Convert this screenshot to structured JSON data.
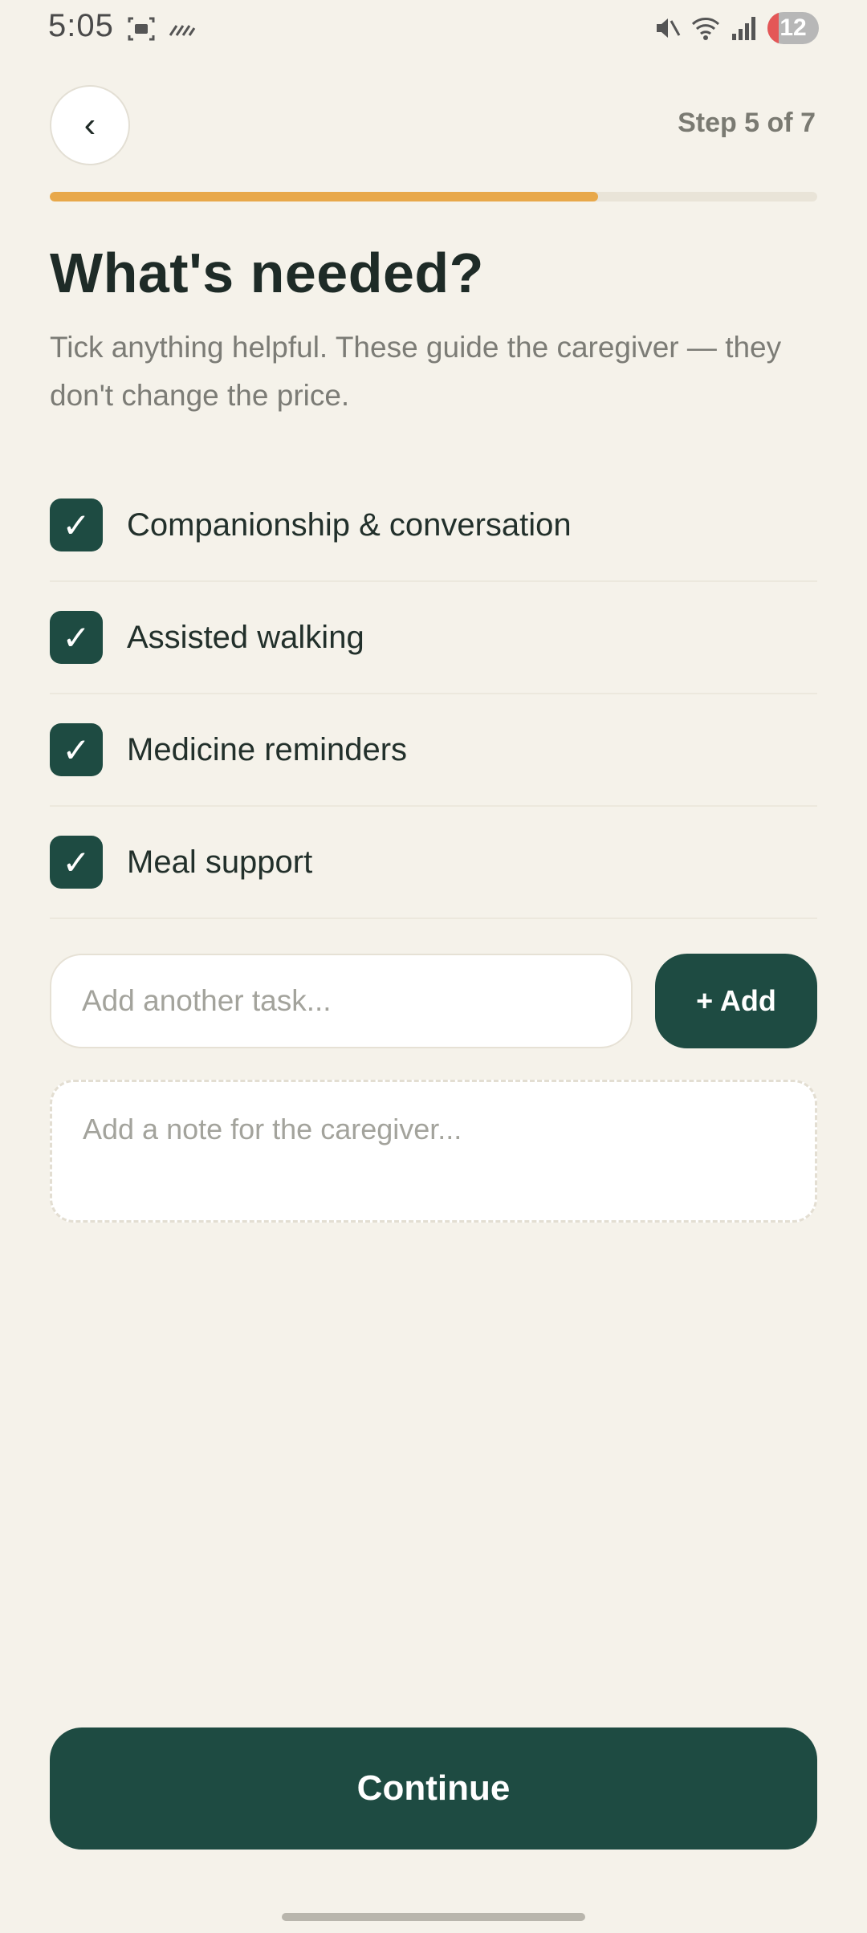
{
  "status_bar": {
    "time": "5:05",
    "left_icons": [
      "screenshot-icon",
      "nfc-icon"
    ],
    "right_icons": [
      "mute-icon",
      "wifi-icon",
      "signal-icon"
    ],
    "notification_count": "12"
  },
  "header": {
    "back_label": "‹",
    "step_label": "Step 5 of 7",
    "progress": 0.714
  },
  "page": {
    "title": "What's needed?",
    "subtitle": "Tick anything helpful. These guide the caregiver — they don't change the price."
  },
  "tasks": [
    {
      "label": "Companionship & conversation",
      "checked": true,
      "check_glyph": "✓"
    },
    {
      "label": "Assisted walking",
      "checked": true,
      "check_glyph": "✓"
    },
    {
      "label": "Medicine reminders",
      "checked": true,
      "check_glyph": "✓"
    },
    {
      "label": "Meal support",
      "checked": true,
      "check_glyph": "✓"
    }
  ],
  "add_task": {
    "placeholder": "Add another task...",
    "button_label": "+ Add"
  },
  "note": {
    "placeholder": "Add a note for the caregiver..."
  },
  "footer": {
    "continue_label": "Continue"
  },
  "colors": {
    "background": "#f5f2ea",
    "primary": "#1e4b42",
    "accent": "#e8a84a"
  }
}
